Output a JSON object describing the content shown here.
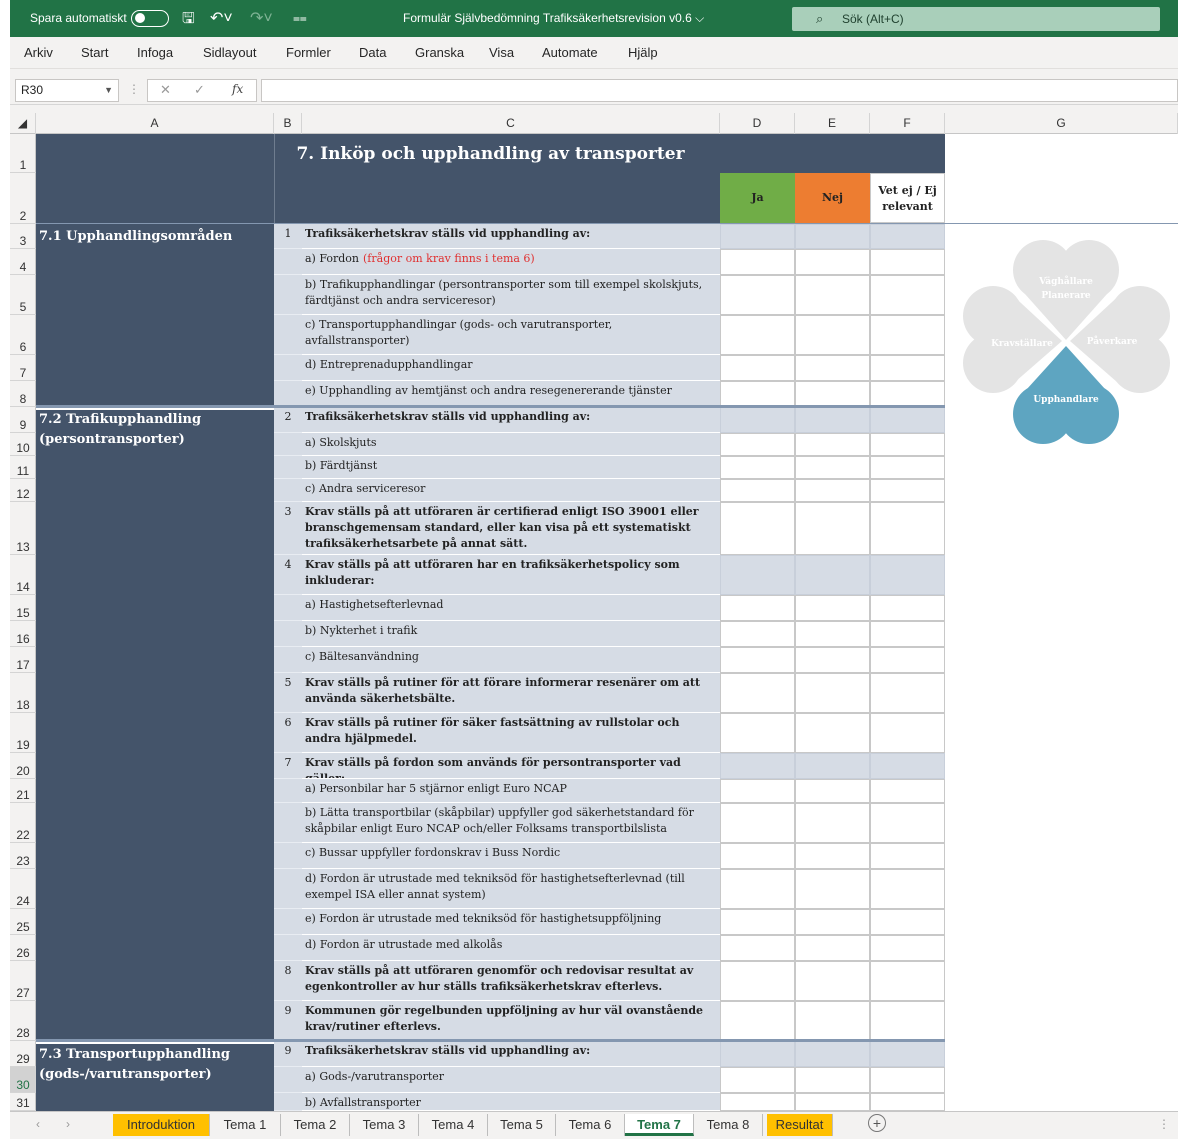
{
  "titlebar": {
    "autosave_label": "Spara automatiskt",
    "file_title": "Formulär Självbedömning Trafiksäkerhetsrevision v0.6",
    "search_placeholder": "Sök (Alt+C)"
  },
  "ribbon": {
    "tabs": [
      "Arkiv",
      "Start",
      "Infoga",
      "Sidlayout",
      "Formler",
      "Data",
      "Granska",
      "Visa",
      "Automate",
      "Hjälp"
    ]
  },
  "formula_bar": {
    "cell_ref": "R30",
    "formula": ""
  },
  "columns": [
    "A",
    "B",
    "C",
    "D",
    "E",
    "F",
    "G"
  ],
  "sheet": {
    "title": "7. Inköp och upphandling av transporter",
    "answer_headers": {
      "ja": "Ja",
      "nej": "Nej",
      "vet_ej": "Vet ej / Ej relevant"
    },
    "sections": [
      {
        "label": "7.1 Upphandlingsområden"
      },
      {
        "label": "7.2 Trafikupphandling (persontransporter)"
      },
      {
        "label": "7.3 Transportupphandling (gods-/varutransporter)"
      }
    ],
    "rows": [
      {
        "row": "3",
        "num": "1",
        "text": "Trafiksäkerhetskrav ställs vid upphandling av:",
        "bold": true,
        "header": true
      },
      {
        "row": "4",
        "num": "",
        "text": "a) Fordon",
        "note": "(frågor om krav finns i tema 6)",
        "bold": false,
        "header": false
      },
      {
        "row": "5",
        "num": "",
        "text": "b) Trafikupphandlingar (persontransporter som till exempel skolskjuts, färdtjänst och andra serviceresor)",
        "bold": false,
        "header": false
      },
      {
        "row": "6",
        "num": "",
        "text": "c) Transportupphandlingar (gods- och varutransporter, avfallstransporter)",
        "bold": false,
        "header": false
      },
      {
        "row": "7",
        "num": "",
        "text": "d) Entreprenadupphandlingar",
        "bold": false,
        "header": false
      },
      {
        "row": "8",
        "num": "",
        "text": "e) Upphandling av hemtjänst och andra resegenererande tjänster",
        "bold": false,
        "header": false
      },
      {
        "row": "9",
        "num": "2",
        "text": "Trafiksäkerhetskrav ställs vid upphandling av:",
        "bold": true,
        "header": true
      },
      {
        "row": "10",
        "num": "",
        "text": "a) Skolskjuts",
        "bold": false,
        "header": false
      },
      {
        "row": "11",
        "num": "",
        "text": "b) Färdtjänst",
        "bold": false,
        "header": false
      },
      {
        "row": "12",
        "num": "",
        "text": "c) Andra serviceresor",
        "bold": false,
        "header": false
      },
      {
        "row": "13",
        "num": "3",
        "text": "Krav ställs på att utföraren är certifierad enligt ISO 39001 eller branschgemensam standard, eller kan visa på ett systematiskt trafiksäkerhetsarbete på annat sätt.",
        "bold": true,
        "header": false
      },
      {
        "row": "14",
        "num": "4",
        "text": "Krav ställs på att utföraren har en trafiksäkerhetspolicy som inkluderar:",
        "bold": true,
        "header": true
      },
      {
        "row": "15",
        "num": "",
        "text": "a) Hastighetsefterlevnad",
        "bold": false,
        "header": false
      },
      {
        "row": "16",
        "num": "",
        "text": "b) Nykterhet i trafik",
        "bold": false,
        "header": false
      },
      {
        "row": "17",
        "num": "",
        "text": "c) Bältesanvändning",
        "bold": false,
        "header": false
      },
      {
        "row": "18",
        "num": "5",
        "text": "Krav ställs på rutiner för att förare informerar resenärer om att använda säkerhetsbälte.",
        "bold": true,
        "header": false
      },
      {
        "row": "19",
        "num": "6",
        "text": "Krav ställs på rutiner för säker fastsättning av rullstolar och andra hjälpmedel.",
        "bold": true,
        "header": false
      },
      {
        "row": "20",
        "num": "7",
        "text": "Krav ställs på fordon som används för persontransporter vad gäller:",
        "bold": true,
        "header": true
      },
      {
        "row": "21",
        "num": "",
        "text": "a) Personbilar har 5 stjärnor enligt Euro NCAP",
        "bold": false,
        "header": false
      },
      {
        "row": "22",
        "num": "",
        "text": "b) Lätta transportbilar (skåpbilar) uppfyller god säkerhetstandard för skåpbilar enligt Euro NCAP och/eller Folksams transportbilslista",
        "bold": false,
        "header": false
      },
      {
        "row": "23",
        "num": "",
        "text": "c) Bussar uppfyller fordonskrav i Buss Nordic",
        "bold": false,
        "header": false
      },
      {
        "row": "24",
        "num": "",
        "text": "d) Fordon är utrustade med tekniksöd för hastighetsefterlevnad (till exempel ISA eller annat system)",
        "bold": false,
        "header": false
      },
      {
        "row": "25",
        "num": "",
        "text": "e) Fordon är utrustade med tekniksöd för hastighetsuppföljning",
        "bold": false,
        "header": false
      },
      {
        "row": "26",
        "num": "",
        "text": "d) Fordon är utrustade med alkolås",
        "bold": false,
        "header": false
      },
      {
        "row": "27",
        "num": "8",
        "text": "Krav ställs på att utföraren genomför och redovisar resultat av egenkontroller av hur ställs trafiksäkerhetskrav efterlevs.",
        "bold": true,
        "header": false
      },
      {
        "row": "28",
        "num": "9",
        "text": "Kommunen gör regelbunden uppföljning av hur väl ovanstående krav/rutiner efterlevs.",
        "bold": true,
        "header": false
      },
      {
        "row": "29",
        "num": "9",
        "text": "Trafiksäkerhetskrav ställs vid upphandling av:",
        "bold": true,
        "header": true
      },
      {
        "row": "30",
        "num": "",
        "text": "a) Gods-/varutransporter",
        "bold": false,
        "header": false
      },
      {
        "row": "31",
        "num": "",
        "text": "b) Avfallstransporter",
        "bold": false,
        "header": false
      }
    ],
    "clover": {
      "top": "Väghållare Planerare",
      "left": "Kravställare",
      "right": "Påverkare",
      "bottom": "Upphandlare"
    }
  },
  "sheet_tabs": [
    "Introduktion",
    "Tema 1",
    "Tema 2",
    "Tema 3",
    "Tema 4",
    "Tema 5",
    "Tema 6",
    "Tema 7",
    "Tema 8",
    "Resultat"
  ],
  "colors": {
    "excel_green": "#217346",
    "navy": "#44546a",
    "answer_ja": "#70ad47",
    "answer_nej": "#ed7d31",
    "tab_yellow": "#ffc000",
    "clover_blue": "#5ea5c1",
    "clover_gray": "#e4e4e4"
  }
}
